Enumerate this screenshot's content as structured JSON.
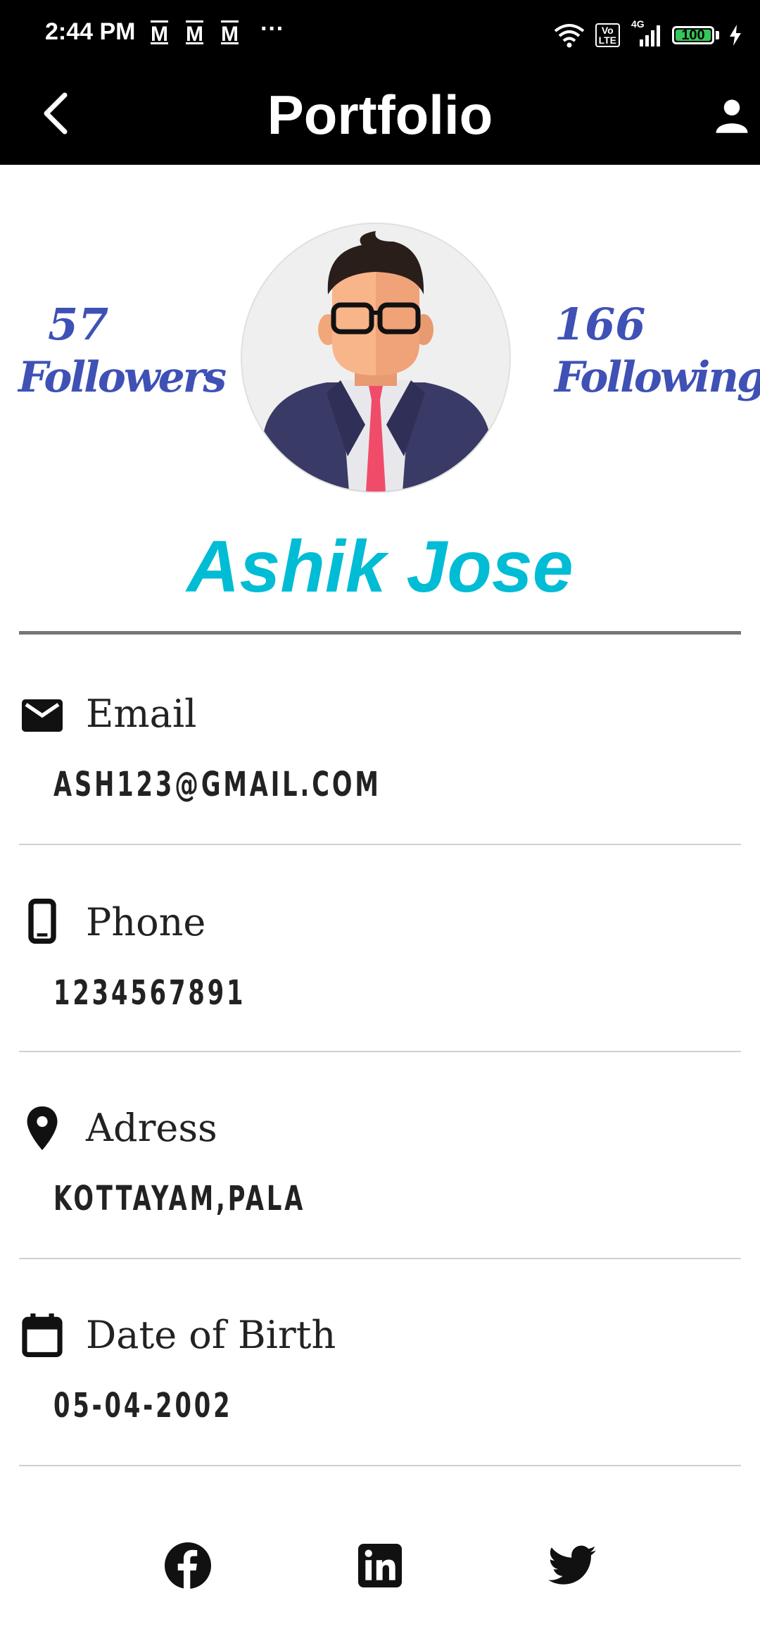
{
  "status_bar": {
    "time": "2:44 PM",
    "mail_icons": [
      "M",
      "M",
      "M"
    ],
    "more_dots": "···",
    "network_top": "4G",
    "lte_label_top": "Vo",
    "lte_label_bottom": "LTE",
    "battery": "100",
    "battery_level": 1.0
  },
  "app_bar": {
    "title": "Portfolio"
  },
  "profile": {
    "followers_count": "57",
    "followers_label": "Followers",
    "following_count": "166",
    "following_label": "Following",
    "name": "Ashik Jose"
  },
  "details": [
    {
      "icon": "mail-icon",
      "label": "Email",
      "value": "ASH123@GMAIL.COM"
    },
    {
      "icon": "phone-icon",
      "label": "Phone",
      "value": "1234567891"
    },
    {
      "icon": "location-pin-icon",
      "label": "Adress",
      "value": "KOTTAYAM,PALA"
    },
    {
      "icon": "calendar-icon",
      "label": "Date of Birth",
      "value": "05-04-2002"
    }
  ],
  "social": [
    "facebook-icon",
    "linkedin-icon",
    "twitter-icon"
  ],
  "colors": {
    "bar_bg": "#000000",
    "stats": "#3f51b5",
    "name": "#00bcd4",
    "text": "#222222"
  }
}
